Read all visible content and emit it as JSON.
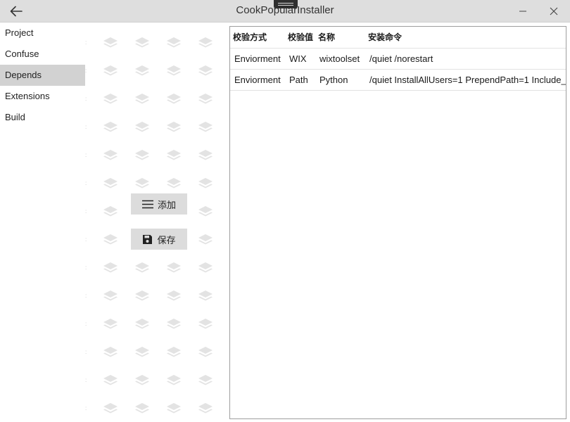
{
  "window": {
    "title": "CookPopularInstaller"
  },
  "sidebar": {
    "items": [
      {
        "label": "Project",
        "active": false
      },
      {
        "label": "Confuse",
        "active": false
      },
      {
        "label": "Depends",
        "active": true
      },
      {
        "label": "Extensions",
        "active": false
      },
      {
        "label": "Build",
        "active": false
      }
    ]
  },
  "actions": {
    "add_label": "添加",
    "save_label": "保存"
  },
  "table": {
    "headers": [
      "校验方式",
      "校验值",
      "名称",
      "安装命令"
    ],
    "rows": [
      [
        "Enviorment",
        "WIX",
        "wixtoolset",
        "/quiet /norestart"
      ],
      [
        "Enviorment",
        "Path",
        "Python",
        "/quiet InstallAllUsers=1 PrependPath=1 Include_"
      ]
    ]
  },
  "icons": {
    "back": "arrow-left-icon",
    "minimize": "minimize-icon",
    "close": "close-icon",
    "add": "hamburger-menu-icon",
    "save": "floppy-disk-icon",
    "background": "layers-icon"
  },
  "colors": {
    "titlebar": "#dedede",
    "nav_active": "#d2d2d2",
    "button_bg": "#dcdcdc",
    "pattern": "#e3e3e3"
  }
}
